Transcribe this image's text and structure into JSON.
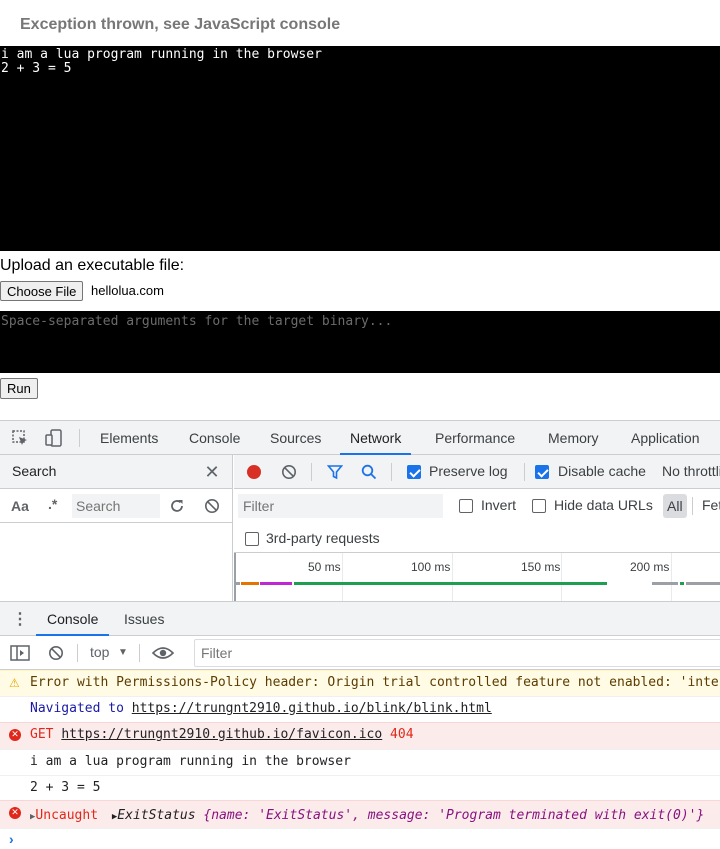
{
  "page": {
    "status": "Exception thrown, see JavaScript console",
    "terminal_lines": "i am a lua program running in the browser\n2 + 3 = 5",
    "upload_label": "Upload an executable file:",
    "choose_file_label": "Choose File",
    "file_name": "hellolua.com",
    "args_placeholder": "Space-separated arguments for the target binary...",
    "run_label": "Run"
  },
  "devtools": {
    "tabs": [
      "Elements",
      "Console",
      "Sources",
      "Network",
      "Performance",
      "Memory",
      "Application"
    ],
    "active_tab": "Network",
    "search": {
      "title": "Search",
      "case_label": "Aa",
      "regex_label": ".*",
      "placeholder": "Search"
    },
    "network": {
      "preserve_log": "Preserve log",
      "disable_cache": "Disable cache",
      "throttle": "No throttling",
      "filter_placeholder": "Filter",
      "invert": "Invert",
      "hide_data_urls": "Hide data URLs",
      "all": "All",
      "fetch": "Fetch/XHR",
      "third_party": "3rd-party requests",
      "timeline_ticks": [
        "50 ms",
        "100 ms",
        "150 ms",
        "200 ms"
      ]
    },
    "drawer": {
      "tabs": [
        "Console",
        "Issues"
      ],
      "context": "top",
      "filter_placeholder": "Filter"
    },
    "console": {
      "warning": "Error with Permissions-Policy header: Origin trial controlled feature not enabled: 'interest-cohort'.",
      "navigated_prefix": "Navigated to",
      "navigated_url": "https://trungnt2910.github.io/blink/blink.html",
      "get_prefix": "GET",
      "get_url": "https://trungnt2910.github.io/favicon.ico",
      "get_status": "404",
      "log1": "i am a lua program running in the browser",
      "log2": "2 + 3 = 5",
      "uncaught": "Uncaught",
      "exit_obj": "ExitStatus",
      "exit_detail": "{name: 'ExitStatus', message: 'Program terminated with exit(0)'}"
    },
    "colors": {
      "accent": "#1a73e8",
      "error": "#e0281a",
      "warning_bg": "#fffbe5",
      "record_red": "#d93025"
    }
  }
}
